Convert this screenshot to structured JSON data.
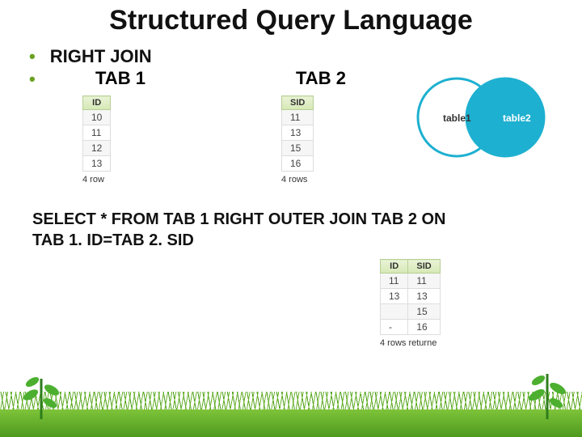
{
  "title": "Structured Query Language",
  "bullets": [
    "RIGHT JOIN"
  ],
  "tables": {
    "tab1": {
      "label": "TAB 1",
      "header": "ID",
      "rows": [
        "10",
        "11",
        "12",
        "13"
      ],
      "rowcount": "4 row"
    },
    "tab2": {
      "label": "TAB 2",
      "header": "SID",
      "rows": [
        "11",
        "13",
        "15",
        "16"
      ],
      "rowcount": "4 rows"
    },
    "result": {
      "headers": [
        "ID",
        "SID"
      ],
      "rows": [
        [
          "11",
          "11"
        ],
        [
          "13",
          "13"
        ],
        [
          "",
          "15"
        ],
        [
          "-",
          "16"
        ]
      ],
      "rowcount": "4 rows returne"
    }
  },
  "venn": {
    "left_label": "table1",
    "right_label": "table2"
  },
  "query_lines": [
    "SELECT * FROM TAB 1 RIGHT OUTER JOIN TAB 2 ON",
    "TAB 1. ID=TAB 2. SID"
  ],
  "colors": {
    "accent": "#1eb0d0",
    "green": "#6aa121"
  }
}
